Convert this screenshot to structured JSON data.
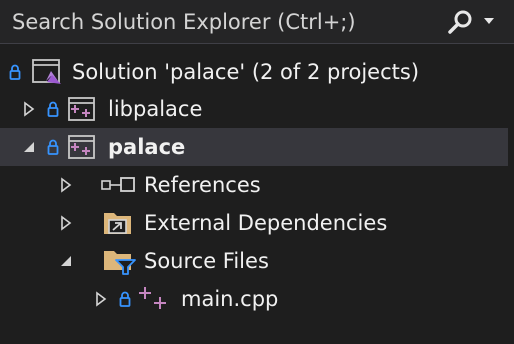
{
  "search": {
    "placeholder": "Search Solution Explorer (Ctrl+;)",
    "icon": "search-icon",
    "options_icon": "caret-down-icon"
  },
  "tree": {
    "solution": {
      "label": "Solution 'palace' (2 of 2 projects)",
      "icon": "solution-icon",
      "locked": true
    },
    "libpalace": {
      "label": "libpalace",
      "icon": "cpp-project-icon",
      "locked": true,
      "expanded": false
    },
    "palace": {
      "label": "palace",
      "icon": "cpp-project-icon",
      "locked": true,
      "expanded": true,
      "selected": true
    },
    "references": {
      "label": "References",
      "icon": "references-icon",
      "expanded": false
    },
    "external": {
      "label": "External Dependencies",
      "icon": "external-dependencies-folder-icon",
      "expanded": false
    },
    "source_files": {
      "label": "Source Files",
      "icon": "filter-folder-icon",
      "expanded": true
    },
    "main_cpp": {
      "label": "main.cpp",
      "icon": "cpp-file-icon",
      "locked": true,
      "expanded": false
    }
  },
  "colors": {
    "background": "#1e1e1e",
    "search_background": "#252526",
    "selection": "#37373d",
    "lock_blue": "#3794ff",
    "cpp_purple": "#c586c0",
    "folder_tan": "#dcb67a"
  }
}
